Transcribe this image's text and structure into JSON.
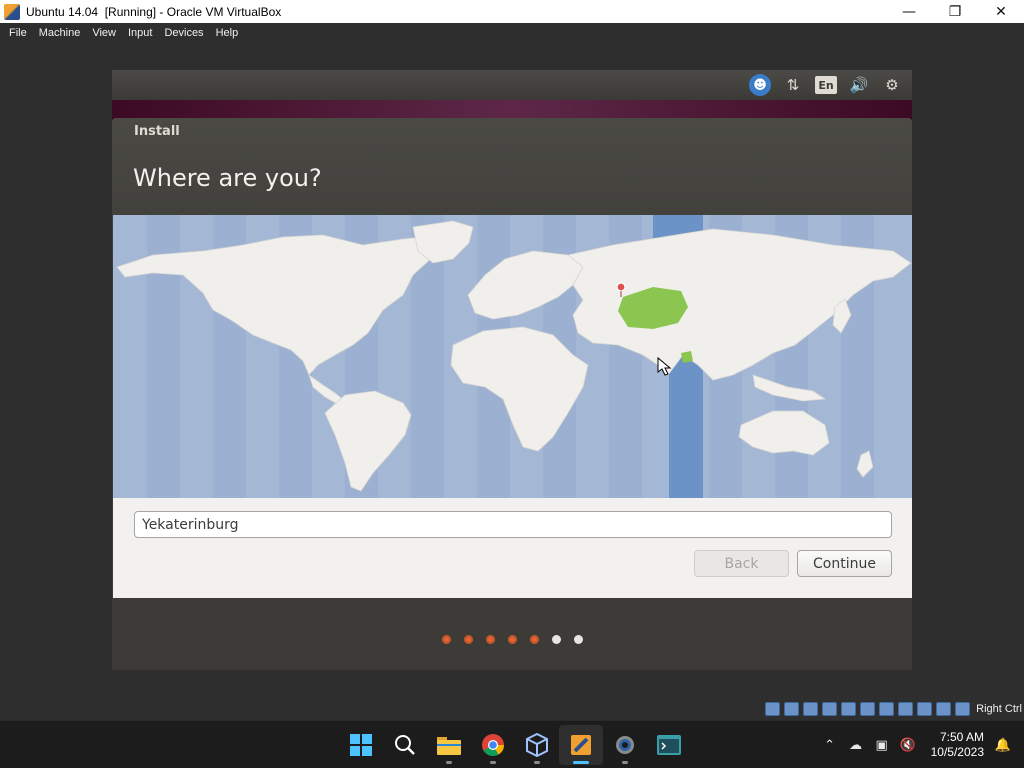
{
  "host_window": {
    "title": "Ubuntu 14.04  [Running] - Oracle VM VirtualBox",
    "minimize": "—",
    "maximize": "❐",
    "close": "✕"
  },
  "vbox_menu": {
    "items": [
      "File",
      "Machine",
      "View",
      "Input",
      "Devices",
      "Help"
    ]
  },
  "ubuntu_panel": {
    "language_indicator": "En",
    "indicators": [
      "accessibility-icon",
      "network-icon",
      "keyboard-language-icon",
      "sound-icon",
      "settings-gear-icon"
    ]
  },
  "installer": {
    "window_title": "Install",
    "heading": "Where are you?",
    "timezone_value": "Yekaterinburg",
    "back_label": "Back",
    "continue_label": "Continue",
    "progress_total_steps": 7,
    "progress_completed_steps": 5,
    "map_colors": {
      "ocean": "#a4b8d6",
      "land": "#f0efec",
      "selected_region": "#8bc650",
      "timezone_band": "#6b93c7"
    }
  },
  "vbox_status": {
    "host_key": "Right Ctrl"
  },
  "taskbar": {
    "apps": [
      "windows-start-icon",
      "search-icon",
      "file-explorer-icon",
      "chrome-icon",
      "virtualbox-icon",
      "virtualbox-vm-icon",
      "settings-icon",
      "terminal-icon"
    ],
    "time": "7:50 AM",
    "date": "10/5/2023"
  }
}
